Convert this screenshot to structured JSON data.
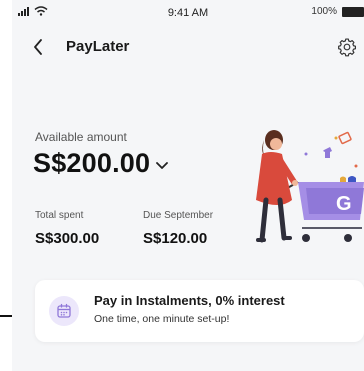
{
  "status_bar": {
    "time": "9:41 AM",
    "battery": "100%"
  },
  "header": {
    "title": "PayLater"
  },
  "balance": {
    "available_label": "Available amount",
    "available_amount": "S$200.00",
    "total_spent_label": "Total spent",
    "total_spent_value": "S$300.00",
    "due_label": "Due September",
    "due_value": "S$120.00"
  },
  "promo": {
    "title": "Pay in Instalments, 0% interest",
    "subtitle": "One time, one minute set-up!"
  },
  "icons": {
    "back": "back-chevron-icon",
    "settings": "gear-icon",
    "amount_dropdown": "chevron-down-icon",
    "promo": "calendar-icon"
  },
  "colors": {
    "accent": "#8f78d8",
    "accent_light": "#ece7fb",
    "background": "#f5f6f8",
    "illustration_red": "#d94a3c"
  }
}
